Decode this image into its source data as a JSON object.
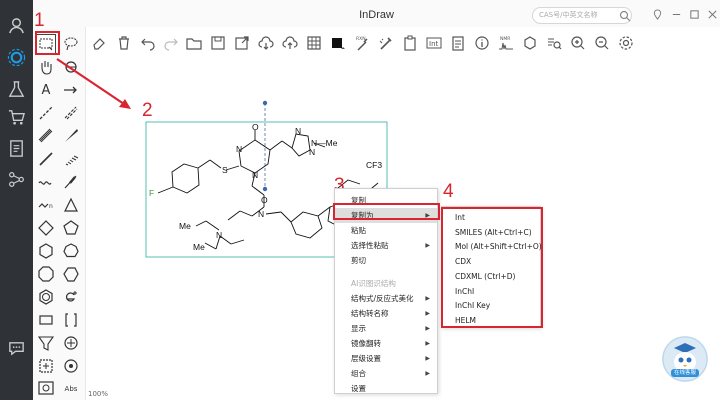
{
  "app": {
    "title": "InDraw"
  },
  "search": {
    "placeholder": "CAS号/中英文名称"
  },
  "canvas": {
    "zoom": "100%"
  },
  "molecule": {
    "atoms": {
      "o": "O",
      "n1": "N",
      "n2": "N",
      "s": "S",
      "f": "F",
      "n3": "N",
      "n4": "N",
      "n_pz": "N",
      "me1": "N—Me",
      "o2": "O",
      "n5": "N",
      "cf3": "CF3",
      "me2": "Me",
      "me3": "Me"
    }
  },
  "context_menu": {
    "items": [
      {
        "label": "复制",
        "has_arrow": false,
        "disabled": false
      },
      {
        "label": "复制为",
        "has_arrow": true,
        "disabled": false,
        "highlighted": true
      },
      {
        "label": "粘贴",
        "has_arrow": false,
        "disabled": false
      },
      {
        "label": "选择性粘贴",
        "has_arrow": true,
        "disabled": false
      },
      {
        "label": "剪切",
        "has_arrow": false,
        "disabled": false
      },
      {
        "label": "AI识图识结构",
        "has_arrow": false,
        "disabled": true
      },
      {
        "label": "结构式/反应式美化",
        "has_arrow": true,
        "disabled": false
      },
      {
        "label": "结构转名称",
        "has_arrow": true,
        "disabled": false
      },
      {
        "label": "显示",
        "has_arrow": true,
        "disabled": false
      },
      {
        "label": "镜像翻转",
        "has_arrow": true,
        "disabled": false
      },
      {
        "label": "层级设置",
        "has_arrow": true,
        "disabled": false
      },
      {
        "label": "组合",
        "has_arrow": true,
        "disabled": false
      },
      {
        "label": "设置",
        "has_arrow": false,
        "disabled": false
      }
    ]
  },
  "submenu": {
    "items": [
      "Int",
      "SMILES (Alt+Ctrl+C)",
      "Mol (Alt+Shift+Ctrl+O)",
      "CDX",
      "CDXML (Ctrl+D)",
      "InChI",
      "InChI Key",
      "HELM"
    ]
  },
  "annotations": {
    "step1": "1",
    "step2": "2",
    "step3": "3",
    "step4": "4"
  },
  "assistant": {
    "label": "在线客服"
  },
  "palette": {
    "abs_label": "Abs",
    "text_tool": "A"
  },
  "colors": {
    "accent": "#d7262f",
    "nav_bg": "#2f3338",
    "active_nav": "#1e9be5",
    "selection": "#2ab0a2"
  }
}
